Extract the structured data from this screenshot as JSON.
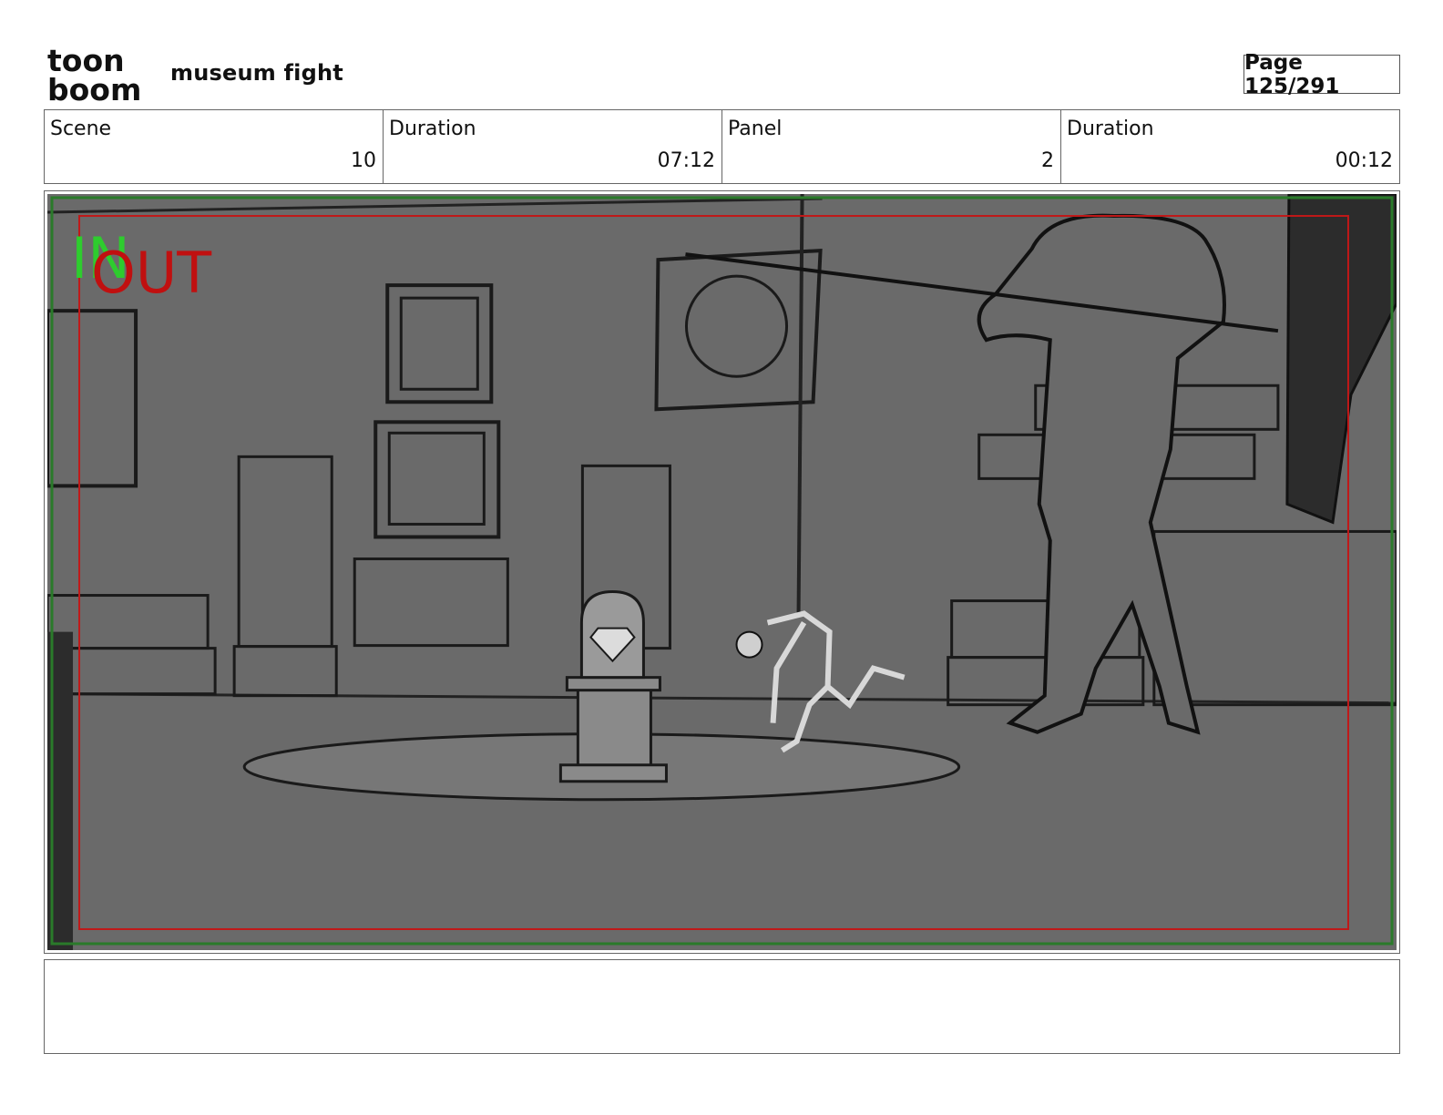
{
  "header": {
    "logo": {
      "line1": "toon",
      "line2": "boom"
    },
    "project_title": "museum fight",
    "page_label": "Page 125/291"
  },
  "info": {
    "scene_label": "Scene",
    "scene_value": "10",
    "scene_duration_label": "Duration",
    "scene_duration_value": "07:12",
    "panel_label": "Panel",
    "panel_value": "2",
    "panel_duration_label": "Duration",
    "panel_duration_value": "00:12"
  },
  "panel": {
    "in_marker": "IN",
    "out_marker": "OUT",
    "colors": {
      "background": "#6a6a6a",
      "safe_frame_green": "#2a7a2a",
      "safe_frame_red": "#c01818",
      "in_green": "#2ecc2e",
      "out_red": "#c01010"
    }
  },
  "notes": {
    "text": ""
  }
}
